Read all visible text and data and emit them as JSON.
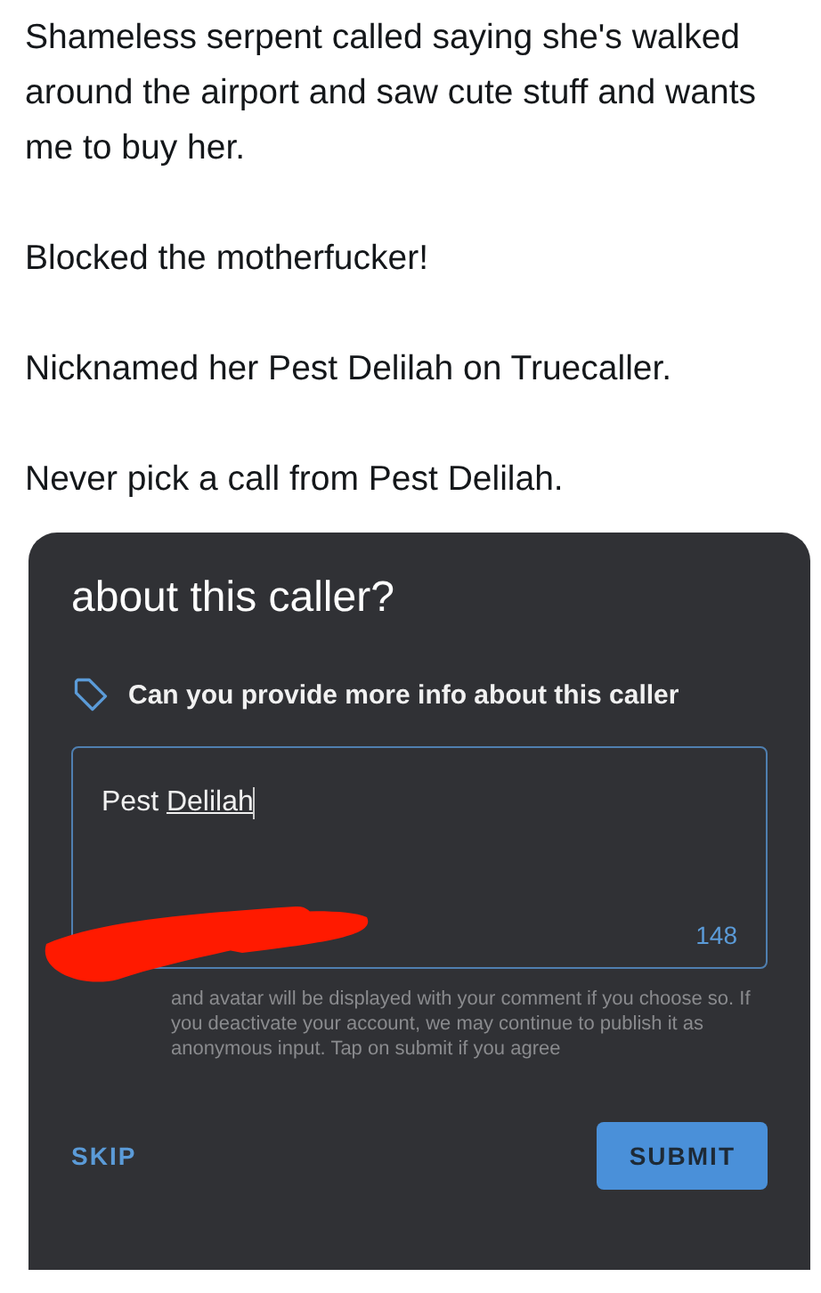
{
  "tweet": {
    "paragraphs": [
      "Shameless serpent called saying she's walked around the airport and saw cute stuff and wants me to buy her.",
      "Blocked the motherfucker!",
      "Nicknamed her Pest Delilah on Truecaller.",
      "Never pick a call from Pest Delilah."
    ]
  },
  "dialog": {
    "title": "about this caller?",
    "prompt": "Can you provide more info about this caller",
    "field": {
      "value_plain": "Pest ",
      "value_underlined": "Delilah",
      "counter": "148"
    },
    "disclaimer": "and avatar will be displayed with your comment if you choose so. If you deactivate your account, we may continue to publish it as anonymous input. Tap on submit if you agree",
    "buttons": [
      {
        "kind": "text",
        "label": "SKIP"
      },
      {
        "kind": "filled",
        "label": "SUBMIT"
      }
    ]
  }
}
